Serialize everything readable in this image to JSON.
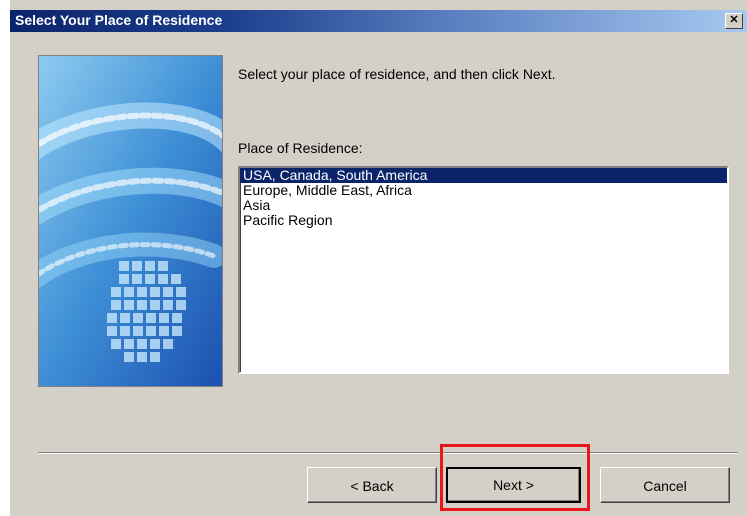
{
  "window": {
    "title": "Select Your Place of Residence",
    "close_glyph": "✕"
  },
  "main": {
    "prompt": "Select your place of residence, and then click Next.",
    "list_label": "Place of Residence:",
    "options": [
      "USA, Canada, South America",
      "Europe, Middle East, Africa",
      "Asia",
      "Pacific Region"
    ],
    "selected_option": "USA, Canada, South America"
  },
  "buttons": {
    "back": "< Back",
    "next": "Next >",
    "cancel": "Cancel"
  },
  "colors": {
    "title_bar": "#0a246a",
    "selection": "#0a246a",
    "highlight_box": "#e8151b",
    "dialog_bg": "#d4d0c8"
  },
  "icons": {
    "close": "close-icon",
    "banner": "banner-graphic"
  }
}
